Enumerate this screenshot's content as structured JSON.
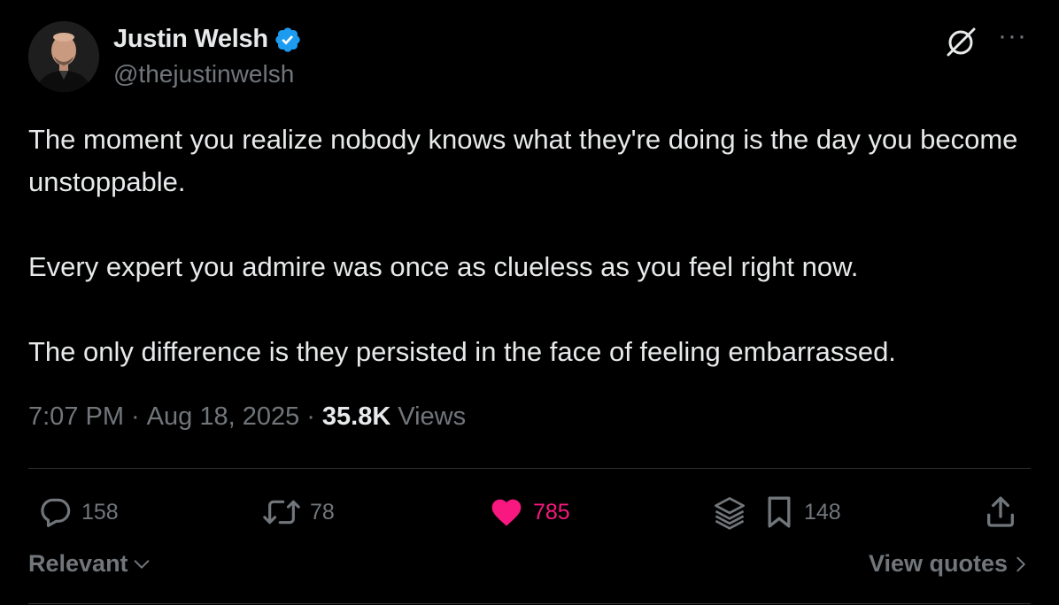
{
  "author": {
    "name": "Justin Welsh",
    "handle": "@thejustinwelsh",
    "verified": true,
    "verified_color": "#1d9bf0"
  },
  "tweet": {
    "paragraphs": [
      "The moment you realize nobody knows what they're doing is the day you become unstoppable.",
      "Every expert you admire was once as clueless as you feel right now.",
      "The only difference is they persisted in the face of feeling embarrassed."
    ],
    "time": "7:07 PM",
    "date": "Aug 18, 2025",
    "views_count": "35.8K",
    "views_label": "Views",
    "separator": "·"
  },
  "actions": {
    "replies": "158",
    "reposts": "78",
    "likes": "785",
    "likes_color": "#f91880",
    "bookmarks": "148"
  },
  "footer": {
    "sort_label": "Relevant",
    "view_quotes_label": "View quotes"
  },
  "icons": {
    "grok": "grok-icon",
    "more": "more-icon",
    "reply": "reply-icon",
    "repost": "repost-icon",
    "like": "heart-icon",
    "grok_analyze": "stack-icon",
    "bookmark": "bookmark-icon",
    "share": "share-icon"
  },
  "more_glyph": "···"
}
